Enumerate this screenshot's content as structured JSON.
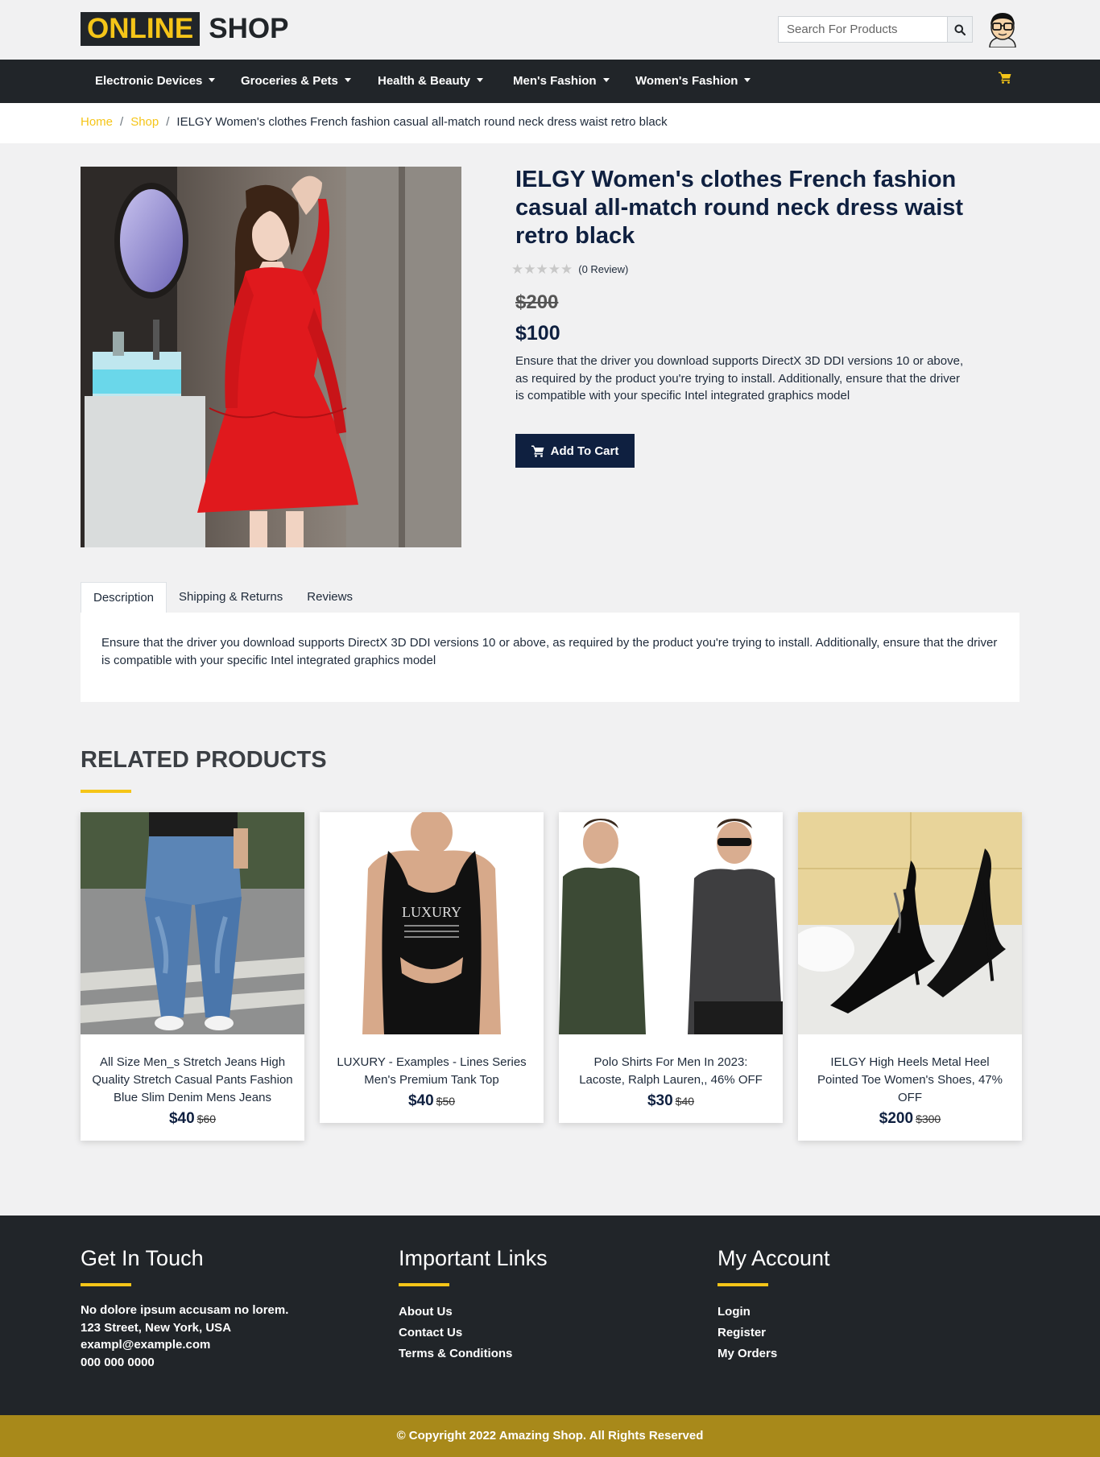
{
  "header": {
    "logo_primary": "ONLINE",
    "logo_secondary": "SHOP",
    "search_placeholder": "Search For Products",
    "search_icon": "search-icon",
    "avatar_icon": "user-avatar-icon"
  },
  "nav": {
    "items": [
      {
        "label": "Electronic Devices"
      },
      {
        "label": "Groceries & Pets"
      },
      {
        "label": "Health & Beauty"
      },
      {
        "label": "Men's Fashion"
      },
      {
        "label": "Women's Fashion"
      }
    ],
    "cart_icon": "shopping-cart-icon"
  },
  "breadcrumb": {
    "home": "Home",
    "shop": "Shop",
    "separator": "/",
    "current": "IELGY Women's clothes French fashion casual all-match round neck dress waist retro black"
  },
  "product": {
    "title": "IELGY Women's clothes French fashion casual all-match round neck dress waist retro black",
    "rating": 0,
    "max_rating": 5,
    "reviews_text": "(0 Review)",
    "old_price": "$200",
    "price": "$100",
    "description": "Ensure that the driver you download supports DirectX 3D DDI versions 10 or above, as required by the product you're trying to install. Additionally, ensure that the driver is compatible with your specific Intel integrated graphics model",
    "add_to_cart": "Add To Cart"
  },
  "tabs": {
    "items": [
      {
        "label": "Description"
      },
      {
        "label": "Shipping & Returns"
      },
      {
        "label": "Reviews"
      }
    ],
    "active": "Description",
    "content": "Ensure that the driver you download supports DirectX 3D DDI versions 10 or above, as required by the product you're trying to install. Additionally, ensure that the driver is compatible with your specific Intel integrated graphics model"
  },
  "related": {
    "title": "RELATED PRODUCTS",
    "products": [
      {
        "name": "All Size Men_s Stretch Jeans High Quality Stretch Casual Pants Fashion Blue Slim Denim Mens Jeans",
        "price": "$40",
        "old_price": "$60"
      },
      {
        "name": "LUXURY - Examples - Lines Series Men's Premium Tank Top",
        "price": "$40",
        "old_price": "$50",
        "image_text": "LUXURY"
      },
      {
        "name": "Polo Shirts For Men In 2023: Lacoste, Ralph Lauren,, 46% OFF",
        "price": "$30",
        "old_price": "$40"
      },
      {
        "name": "IELGY High Heels Metal Heel Pointed Toe Women's Shoes, 47% OFF",
        "price": "$200",
        "old_price": "$300"
      }
    ]
  },
  "footer": {
    "contact": {
      "title": "Get In Touch",
      "lines": [
        "No dolore ipsum accusam no lorem.",
        "123 Street, New York, USA",
        "exampl@example.com",
        "000 000 0000"
      ]
    },
    "links": {
      "title": "Important Links",
      "items": [
        "About Us",
        "Contact Us",
        "Terms & Conditions"
      ]
    },
    "account": {
      "title": "My Account",
      "items": [
        "Login",
        "Register",
        "My Orders"
      ]
    },
    "copyright": "© Copyright 2022 Amazing Shop. All Rights Reserved"
  },
  "colors": {
    "accent": "#f5c518",
    "dark": "#212529",
    "navy": "#0f2040",
    "copyright_bar": "#a8891a"
  }
}
